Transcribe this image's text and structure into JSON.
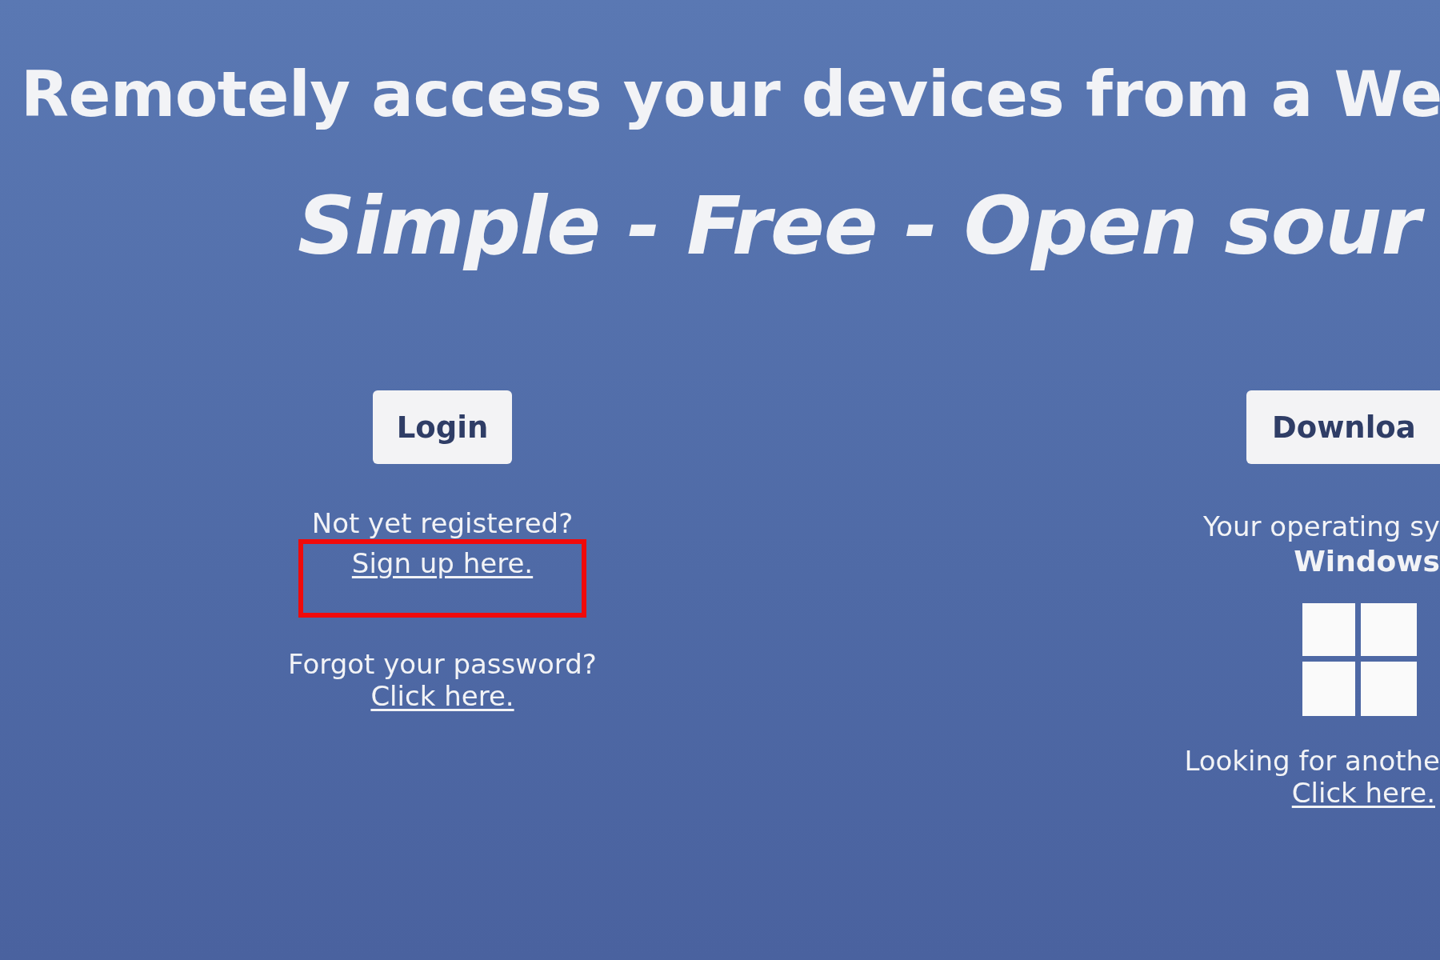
{
  "headline": "Remotely access your devices from a We",
  "tagline": "Simple - Free - Open sour",
  "login": {
    "button": "Login",
    "signup_prompt": "Not yet registered?",
    "signup_link": "Sign up here.",
    "signup_highlighted": true,
    "forgot_prompt": "Forgot your password?",
    "forgot_link": "Click here."
  },
  "download": {
    "button": "Downloa",
    "os_label": "Your operating sy",
    "os_name": "Windows",
    "other_prompt": "Looking for anothe",
    "other_link": "Click here."
  }
}
